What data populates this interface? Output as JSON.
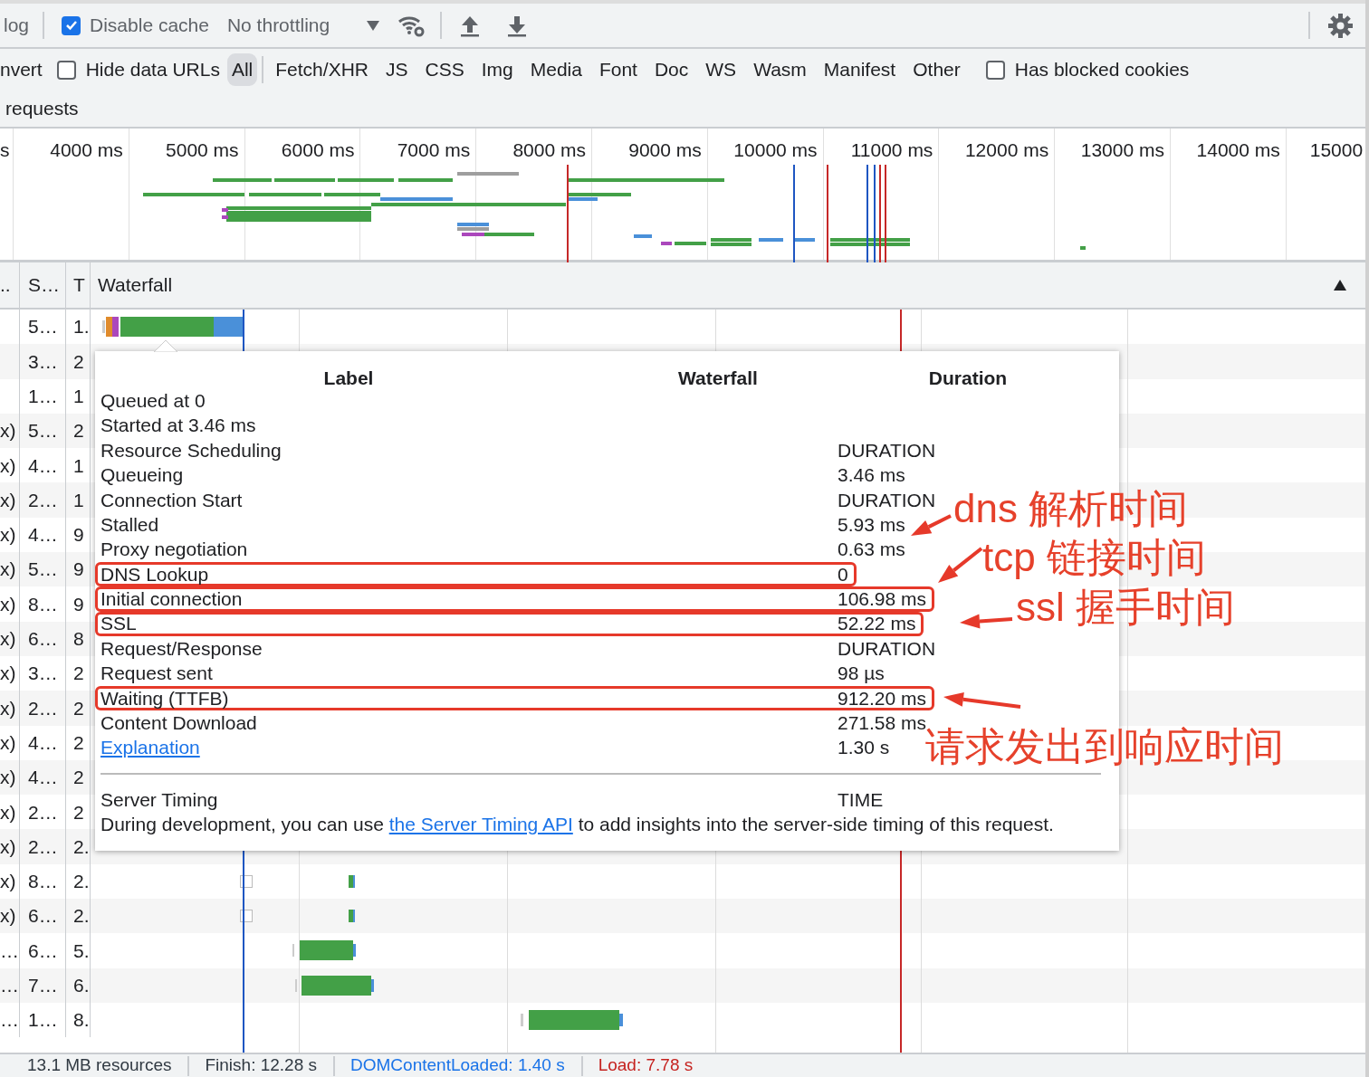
{
  "toolbar": {
    "preserve_log_label": "log",
    "disable_cache": {
      "label": "Disable cache",
      "checked": true
    },
    "throttling": {
      "value": "No throttling"
    }
  },
  "filter_bar": {
    "invert_label": "nvert",
    "hide_data_urls": {
      "label": "Hide data URLs",
      "checked": false
    },
    "types": [
      {
        "label": "All",
        "selected": true
      },
      {
        "label": "Fetch/XHR",
        "selected": false
      },
      {
        "label": "JS",
        "selected": false
      },
      {
        "label": "CSS",
        "selected": false
      },
      {
        "label": "Img",
        "selected": false
      },
      {
        "label": "Media",
        "selected": false
      },
      {
        "label": "Font",
        "selected": false
      },
      {
        "label": "Doc",
        "selected": false
      },
      {
        "label": "WS",
        "selected": false
      },
      {
        "label": "Wasm",
        "selected": false
      },
      {
        "label": "Manifest",
        "selected": false
      },
      {
        "label": "Other",
        "selected": false
      }
    ],
    "blocked_cookies": {
      "label": "Has blocked cookies",
      "checked": false
    }
  },
  "requests_label": "requests",
  "overview": {
    "ticks": [
      "s",
      "4000 ms",
      "5000 ms",
      "6000 ms",
      "7000 ms",
      "8000 ms",
      "9000 ms",
      "10000 ms",
      "11000 ms",
      "12000 ms",
      "13000 ms",
      "14000 ms",
      "15000"
    ]
  },
  "table": {
    "columns": [
      "..",
      "S…",
      "T",
      "Waterfall"
    ],
    "rows": [
      {
        "column_2": "5…",
        "column_3": "1."
      },
      {
        "column_2": "3…",
        "column_3": "2"
      },
      {
        "column_2": "1…",
        "column_3": "1"
      },
      {
        "column_1": "x)",
        "column_2": "5…",
        "column_3": "2"
      },
      {
        "column_1": "x)",
        "column_2": "4…",
        "column_3": "1"
      },
      {
        "column_1": "x)",
        "column_2": "2…",
        "column_3": "1"
      },
      {
        "column_1": "x)",
        "column_2": "4…",
        "column_3": "9"
      },
      {
        "column_1": "x)",
        "column_2": "5…",
        "column_3": "9"
      },
      {
        "column_1": "x)",
        "column_2": "8…",
        "column_3": "9"
      },
      {
        "column_1": "x)",
        "column_2": "6…",
        "column_3": "8"
      },
      {
        "column_1": "x)",
        "column_2": "3…",
        "column_3": "2"
      },
      {
        "column_1": "x)",
        "column_2": "2…",
        "column_3": "2"
      },
      {
        "column_1": "x)",
        "column_2": "4…",
        "column_3": "2"
      },
      {
        "column_1": "x)",
        "column_2": "4…",
        "column_3": "2"
      },
      {
        "column_1": "x)",
        "column_2": "2…",
        "column_3": "2"
      },
      {
        "column_1": "x)",
        "column_2": "2…",
        "column_3": "2."
      },
      {
        "column_1": "x)",
        "column_2": "8…",
        "column_3": "2."
      },
      {
        "column_1": "x)",
        "column_2": "6…",
        "column_3": "2."
      },
      {
        "column_1": "…",
        "column_2": "6…",
        "column_3": "5."
      },
      {
        "column_1": "…",
        "column_2": "7…",
        "column_3": "6."
      },
      {
        "column_1": "…",
        "column_2": "1…",
        "column_3": "8."
      }
    ]
  },
  "tooltip": {
    "headers": [
      "Label",
      "Waterfall",
      "Duration"
    ],
    "rows": [
      {
        "kind": "text",
        "label": "Queued at 0",
        "highlighted": false
      },
      {
        "kind": "text",
        "label": "Started at 3.46 ms",
        "highlighted": false
      },
      {
        "kind": "text",
        "label": "Resource Scheduling",
        "value": "DURATION",
        "highlighted": false
      },
      {
        "kind": "text",
        "label": "Queueing",
        "value": "3.46 ms",
        "highlighted": false
      },
      {
        "kind": "text",
        "label": "Connection Start",
        "value": "DURATION",
        "highlighted": false
      },
      {
        "kind": "text",
        "label": "Stalled",
        "value": "5.93 ms",
        "highlighted": false
      },
      {
        "kind": "text",
        "label": "Proxy negotiation",
        "value": "0.63 ms",
        "highlighted": false
      },
      {
        "kind": "text",
        "label": "DNS Lookup",
        "value": "0",
        "highlighted": true
      },
      {
        "kind": "text",
        "label": "Initial connection",
        "value": "106.98 ms",
        "highlighted": true
      },
      {
        "kind": "text",
        "label": "SSL",
        "value": "52.22 ms",
        "highlighted": true
      },
      {
        "kind": "text",
        "label": "Request/Response",
        "value": "DURATION",
        "highlighted": false
      },
      {
        "kind": "text",
        "label": "Request sent",
        "value": "98 µs",
        "highlighted": false
      },
      {
        "kind": "text",
        "label": "Waiting (TTFB)",
        "value": "912.20 ms",
        "highlighted": true
      },
      {
        "kind": "text",
        "label": "Content Download",
        "value": "271.58 ms",
        "highlighted": false
      },
      {
        "kind": "link",
        "label": "Explanation",
        "value": "1.30 s",
        "highlighted": false
      }
    ],
    "server_timing": {
      "label": "Server Timing",
      "value": "TIME",
      "note_before": "During development, you can use ",
      "note_link": "the Server Timing API",
      "note_after": " to add insights into the server-side timing of this request."
    }
  },
  "annotations": [
    {
      "text": "dns 解析时间"
    },
    {
      "text": "tcp 链接时间"
    },
    {
      "text": "ssl 握手时间"
    },
    {
      "text": "请求发出到响应时间"
    }
  ],
  "status_bar": [
    {
      "text": "13.1 MB resources",
      "kind": "plain"
    },
    {
      "text": "Finish: 12.28 s",
      "kind": "plain"
    },
    {
      "text": "DOMContentLoaded: 1.40 s",
      "kind": "dom"
    },
    {
      "text": "Load: 7.78 s",
      "kind": "load"
    }
  ]
}
